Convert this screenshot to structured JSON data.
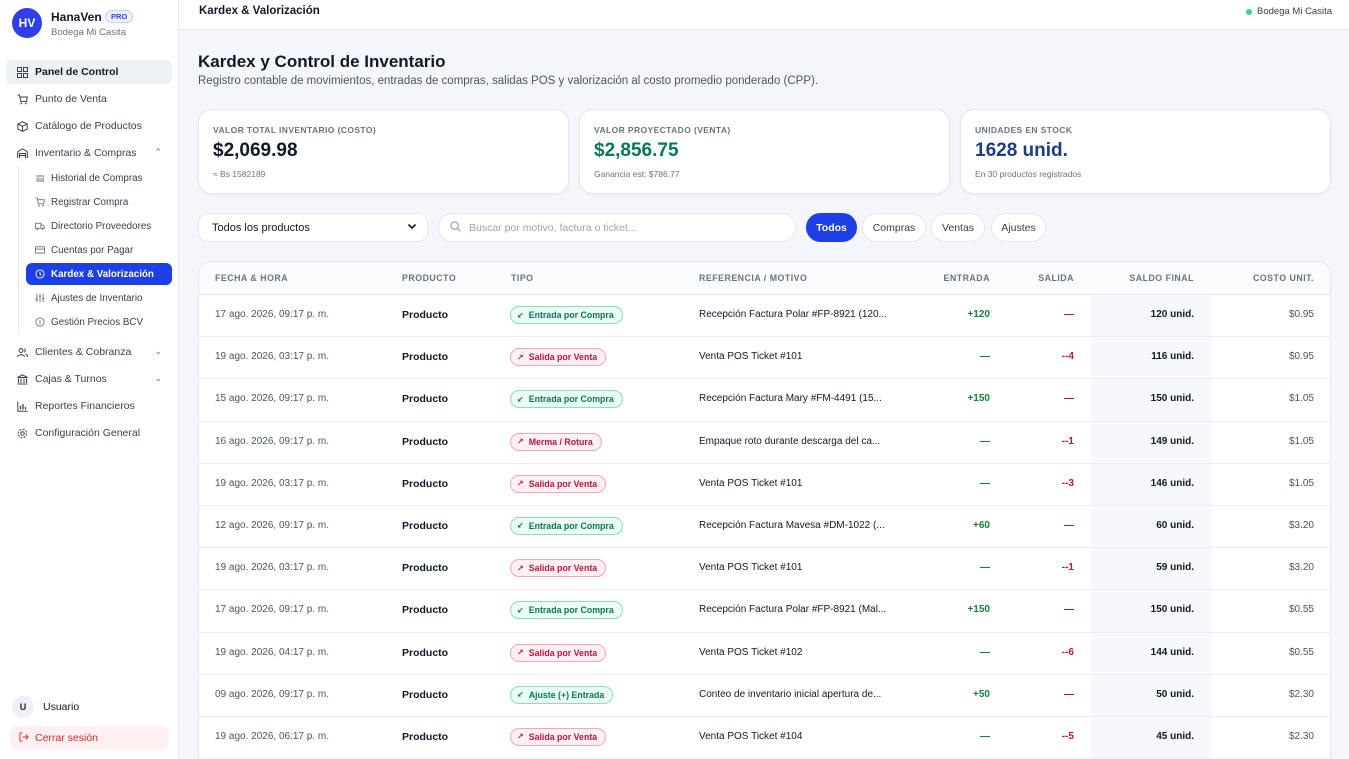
{
  "brand": {
    "initials": "HV",
    "name": "HanaVen",
    "badge": "PRO",
    "store": "Bodega Mi Casita"
  },
  "sidebar": {
    "items": [
      {
        "label": "Panel de Control",
        "icon": "grid-icon"
      },
      {
        "label": "Punto de Venta",
        "icon": "cart-icon"
      },
      {
        "label": "Catálogo de Productos",
        "icon": "box-icon"
      },
      {
        "label": "Inventario & Compras",
        "icon": "warehouse-icon"
      },
      {
        "label": "Clientes & Cobranza",
        "icon": "users-icon"
      },
      {
        "label": "Cajas & Turnos",
        "icon": "bank-icon"
      },
      {
        "label": "Reportes Financieros",
        "icon": "bar-chart-icon"
      },
      {
        "label": "Configuración General",
        "icon": "gear-icon"
      }
    ],
    "subitems": [
      {
        "label": "Historial de Compras",
        "icon": "list-icon"
      },
      {
        "label": "Registrar Compra",
        "icon": "cart-icon"
      },
      {
        "label": "Directorio Proveedores",
        "icon": "truck-icon"
      },
      {
        "label": "Cuentas por Pagar",
        "icon": "card-icon"
      },
      {
        "label": "Kardex & Valorización",
        "icon": "history-icon"
      },
      {
        "label": "Ajustes de Inventario",
        "icon": "sliders-icon"
      },
      {
        "label": "Gestión Precios BCV",
        "icon": "coin-icon"
      }
    ],
    "user": {
      "initial": "U",
      "name": "Usuario"
    },
    "logout": "Cerrar sesión"
  },
  "topbar": {
    "breadcrumb": "Kardex & Valorización",
    "store": "Bodega Mi Casita",
    "status_color": "#34d399"
  },
  "page": {
    "title": "Kardex y Control de Inventario",
    "description": "Registro contable de movimientos, entradas de compras, salidas POS y valorización al costo promedio ponderado (CPP)."
  },
  "cards": [
    {
      "label": "VALOR TOTAL INVENTARIO (COSTO)",
      "value": "$2,069.98",
      "note": "≈ Bs 1582189",
      "color": "#111827"
    },
    {
      "label": "VALOR PROYECTADO (VENTA)",
      "value": "$2,856.75",
      "note": "Ganancia est: $786.77",
      "color": "#047857"
    },
    {
      "label": "UNIDADES EN STOCK",
      "value": "1628 unid.",
      "note": "En 30 productos registrados",
      "color": "#1e3a8a"
    }
  ],
  "filters": {
    "product_select": "Todos los productos",
    "search_placeholder": "Buscar por motivo, factura o ticket...",
    "pills": [
      "Todos",
      "Compras",
      "Ventas",
      "Ajustes"
    ],
    "active_pill": "Todos"
  },
  "table": {
    "headers": [
      "FECHA & HORA",
      "PRODUCTO",
      "TIPO",
      "REFERENCIA / MOTIVO",
      "ENTRADA",
      "SALIDA",
      "SALDO FINAL",
      "COSTO UNIT."
    ],
    "rows": [
      {
        "date": "17 ago. 2026, 09:17 p. m.",
        "product": "Producto",
        "type": "Entrada por Compra",
        "kind": "in",
        "ref": "Recepción Factura Polar #FP-8921 (120...",
        "in": "+120",
        "out": "—",
        "saldo": "120 unid.",
        "cost": "$0.95"
      },
      {
        "date": "19 ago. 2026, 03:17 p. m.",
        "product": "Producto",
        "type": "Salida por Venta",
        "kind": "out",
        "ref": "Venta POS Ticket #101",
        "in": "—",
        "out": "--4",
        "saldo": "116 unid.",
        "cost": "$0.95"
      },
      {
        "date": "15 ago. 2026, 09:17 p. m.",
        "product": "Producto",
        "type": "Entrada por Compra",
        "kind": "in",
        "ref": "Recepción Factura Mary #FM-4491 (15...",
        "in": "+150",
        "out": "—",
        "saldo": "150 unid.",
        "cost": "$1.05"
      },
      {
        "date": "16 ago. 2026, 09:17 p. m.",
        "product": "Producto",
        "type": "Merma / Rotura",
        "kind": "out",
        "ref": "Empaque roto durante descarga del ca...",
        "in": "—",
        "out": "--1",
        "saldo": "149 unid.",
        "cost": "$1.05"
      },
      {
        "date": "19 ago. 2026, 03:17 p. m.",
        "product": "Producto",
        "type": "Salida por Venta",
        "kind": "out",
        "ref": "Venta POS Ticket #101",
        "in": "—",
        "out": "--3",
        "saldo": "146 unid.",
        "cost": "$1.05"
      },
      {
        "date": "12 ago. 2026, 09:17 p. m.",
        "product": "Producto",
        "type": "Entrada por Compra",
        "kind": "in",
        "ref": "Recepción Factura Mavesa #DM-1022 (...",
        "in": "+60",
        "out": "—",
        "saldo": "60 unid.",
        "cost": "$3.20"
      },
      {
        "date": "19 ago. 2026, 03:17 p. m.",
        "product": "Producto",
        "type": "Salida por Venta",
        "kind": "out",
        "ref": "Venta POS Ticket #101",
        "in": "—",
        "out": "--1",
        "saldo": "59 unid.",
        "cost": "$3.20"
      },
      {
        "date": "17 ago. 2026, 09:17 p. m.",
        "product": "Producto",
        "type": "Entrada por Compra",
        "kind": "in",
        "ref": "Recepción Factura Polar #FP-8921 (Mal...",
        "in": "+150",
        "out": "—",
        "saldo": "150 unid.",
        "cost": "$0.55"
      },
      {
        "date": "19 ago. 2026, 04:17 p. m.",
        "product": "Producto",
        "type": "Salida por Venta",
        "kind": "out",
        "ref": "Venta POS Ticket #102",
        "in": "—",
        "out": "--6",
        "saldo": "144 unid.",
        "cost": "$0.55"
      },
      {
        "date": "09 ago. 2026, 09:17 p. m.",
        "product": "Producto",
        "type": "Ajuste (+) Entrada",
        "kind": "in",
        "ref": "Conteo de inventario inicial apertura de...",
        "in": "+50",
        "out": "—",
        "saldo": "50 unid.",
        "cost": "$2.30"
      },
      {
        "date": "19 ago. 2026, 06:17 p. m.",
        "product": "Producto",
        "type": "Salida por Venta",
        "kind": "out",
        "ref": "Venta POS Ticket #104",
        "in": "—",
        "out": "--5",
        "saldo": "45 unid.",
        "cost": "$2.30"
      }
    ]
  }
}
